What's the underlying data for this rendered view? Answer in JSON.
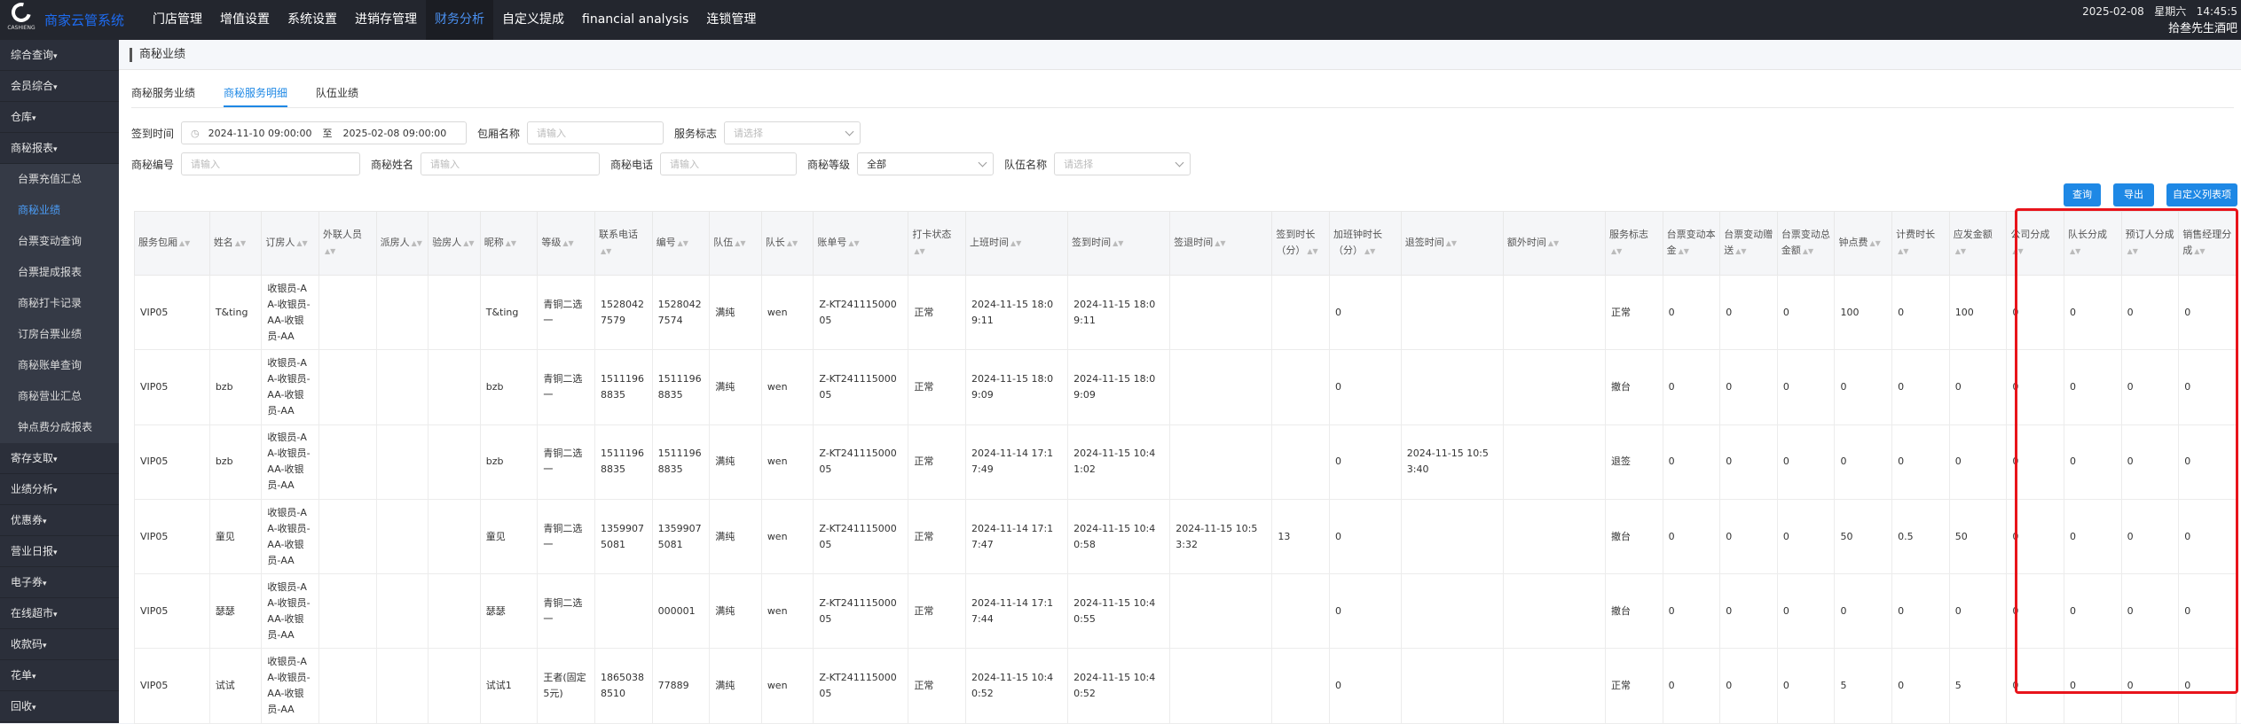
{
  "app": {
    "name": "商家云管系统",
    "logo_text": "CASHIENG"
  },
  "topnav": [
    "门店管理",
    "增值设置",
    "系统设置",
    "进销存管理",
    "财务分析",
    "自定义提成",
    "financial analysis",
    "连锁管理"
  ],
  "topnav_active": 4,
  "topright": {
    "date": "2025-02-08",
    "weekday": "星期六",
    "time": "14:45:5",
    "store": "拾叁先生酒吧"
  },
  "sidebar": [
    {
      "label": "综合查询",
      "caret": "▾",
      "type": "group"
    },
    {
      "label": "会员综合",
      "caret": "▾",
      "type": "group"
    },
    {
      "label": "仓库",
      "caret": "▾",
      "type": "group"
    },
    {
      "label": "商秘报表",
      "caret": "▾",
      "type": "group"
    },
    {
      "label": "台票充值汇总",
      "caret": "",
      "type": "sub"
    },
    {
      "label": "商秘业绩",
      "caret": "",
      "type": "active"
    },
    {
      "label": "台票变动查询",
      "caret": "",
      "type": "sub"
    },
    {
      "label": "台票提成报表",
      "caret": "",
      "type": "sub"
    },
    {
      "label": "商秘打卡记录",
      "caret": "",
      "type": "sub"
    },
    {
      "label": "订房台票业绩",
      "caret": "",
      "type": "sub"
    },
    {
      "label": "商秘账单查询",
      "caret": "",
      "type": "sub"
    },
    {
      "label": "商秘营业汇总",
      "caret": "",
      "type": "sub"
    },
    {
      "label": "钟点费分成报表",
      "caret": "",
      "type": "sub"
    },
    {
      "label": "寄存支取",
      "caret": "▾",
      "type": "group"
    },
    {
      "label": "业绩分析",
      "caret": "▾",
      "type": "group"
    },
    {
      "label": "优惠券",
      "caret": "▾",
      "type": "group"
    },
    {
      "label": "营业日报",
      "caret": "▾",
      "type": "group"
    },
    {
      "label": "电子券",
      "caret": "▾",
      "type": "group"
    },
    {
      "label": "在线超市",
      "caret": "▾",
      "type": "group"
    },
    {
      "label": "收款码",
      "caret": "▾",
      "type": "group"
    },
    {
      "label": "花单",
      "caret": "▾",
      "type": "group"
    },
    {
      "label": "回收",
      "caret": "▾",
      "type": "group"
    }
  ],
  "breadcrumb": "商秘业绩",
  "tabs": [
    "商秘服务业绩",
    "商秘服务明细",
    "队伍业绩"
  ],
  "tabs_active": 1,
  "filters": {
    "checkin_label": "签到时间",
    "date_start": "2024-11-10 09:00:00",
    "date_sep": "至",
    "date_end": "2025-02-08 09:00:00",
    "room_label": "包厢名称",
    "room_ph": "请输入",
    "flag_label": "服务标志",
    "flag_ph": "请选择",
    "code_label": "商秘编号",
    "code_ph": "请输入",
    "name_label": "商秘姓名",
    "name_ph": "请输入",
    "phone_label": "商秘电话",
    "phone_ph": "请输入",
    "level_label": "商秘等级",
    "level_value": "全部",
    "team_label": "队伍名称",
    "team_ph": "请选择"
  },
  "buttons": {
    "query": "查询",
    "export": "导出",
    "custom": "自定义列表项"
  },
  "table": {
    "columns": [
      "服务包厢",
      "姓名",
      "订房人",
      "外联人员",
      "派房人",
      "验房人",
      "昵称",
      "等级",
      "联系电话",
      "编号",
      "队伍",
      "队长",
      "账单号",
      "打卡状态",
      "上班时间",
      "签到时间",
      "签退时间",
      "签到时长（分）",
      "加班钟时长（分）",
      "退签时间",
      "额外时间",
      "服务标志",
      "台票变动本金",
      "台票变动赠送",
      "台票变动总金额",
      "钟点费",
      "计费时长",
      "应发金额",
      "公司分成",
      "队长分成",
      "预订人分成",
      "销售经理分成"
    ],
    "rows": [
      [
        "VIP05",
        "T&ting",
        "收银员-AA-收银员-AA-收银员-AA",
        "",
        "",
        "",
        "T&ting",
        "青铜二选一",
        "15280427579",
        "15280427574",
        "满纯",
        "wen",
        "Z-KT24111500005",
        "正常",
        "2024-11-15 18:09:11",
        "2024-11-15 18:09:11",
        "",
        "",
        "0",
        "",
        "",
        "正常",
        "0",
        "0",
        "0",
        "100",
        "0",
        "100",
        "0",
        "0",
        "0",
        "0"
      ],
      [
        "VIP05",
        "bzb",
        "收银员-AA-收银员-AA-收银员-AA",
        "",
        "",
        "",
        "bzb",
        "青铜二选一",
        "15111968835",
        "15111968835",
        "满纯",
        "wen",
        "Z-KT24111500005",
        "正常",
        "2024-11-15 18:09:09",
        "2024-11-15 18:09:09",
        "",
        "",
        "0",
        "",
        "",
        "撤台",
        "0",
        "0",
        "0",
        "0",
        "0",
        "0",
        "0",
        "0",
        "0",
        "0"
      ],
      [
        "VIP05",
        "bzb",
        "收银员-AA-收银员-AA-收银员-AA",
        "",
        "",
        "",
        "bzb",
        "青铜二选一",
        "15111968835",
        "15111968835",
        "满纯",
        "wen",
        "Z-KT24111500005",
        "正常",
        "2024-11-14 17:17:49",
        "2024-11-15 10:41:02",
        "",
        "",
        "0",
        "2024-11-15 10:53:40",
        "",
        "退签",
        "0",
        "0",
        "0",
        "0",
        "0",
        "0",
        "0",
        "0",
        "0",
        "0"
      ],
      [
        "VIP05",
        "童见",
        "收银员-AA-收银员-AA-收银员-AA",
        "",
        "",
        "",
        "童见",
        "青铜二选一",
        "13599075081",
        "13599075081",
        "满纯",
        "wen",
        "Z-KT24111500005",
        "正常",
        "2024-11-14 17:17:47",
        "2024-11-15 10:40:58",
        "2024-11-15 10:53:32",
        "13",
        "0",
        "",
        "",
        "撤台",
        "0",
        "0",
        "0",
        "50",
        "0.5",
        "50",
        "0",
        "0",
        "0",
        "0"
      ],
      [
        "VIP05",
        "瑟瑟",
        "收银员-AA-收银员-AA-收银员-AA",
        "",
        "",
        "",
        "瑟瑟",
        "青铜二选一",
        "",
        "000001",
        "满纯",
        "wen",
        "Z-KT24111500005",
        "正常",
        "2024-11-14 17:17:44",
        "2024-11-15 10:40:55",
        "",
        "",
        "0",
        "",
        "",
        "撤台",
        "0",
        "0",
        "0",
        "0",
        "0",
        "0",
        "0",
        "0",
        "0",
        "0"
      ],
      [
        "VIP05",
        "试试",
        "收银员-AA-收银员-AA-收银员-AA",
        "",
        "",
        "",
        "试试1",
        "王者(固定5元)",
        "18650388510",
        "77889",
        "满纯",
        "wen",
        "Z-KT24111500005",
        "正常",
        "2024-11-15 10:40:52",
        "2024-11-15 10:40:52",
        "",
        "",
        "0",
        "",
        "",
        "正常",
        "0",
        "0",
        "0",
        "5",
        "0",
        "5",
        "0",
        "0",
        "0",
        "0"
      ]
    ]
  },
  "colors": {
    "accent": "#1e88e5",
    "highlight": "#e8141b",
    "sidebar_bg": "#2b2f3a",
    "topbar_bg": "#23262e"
  }
}
